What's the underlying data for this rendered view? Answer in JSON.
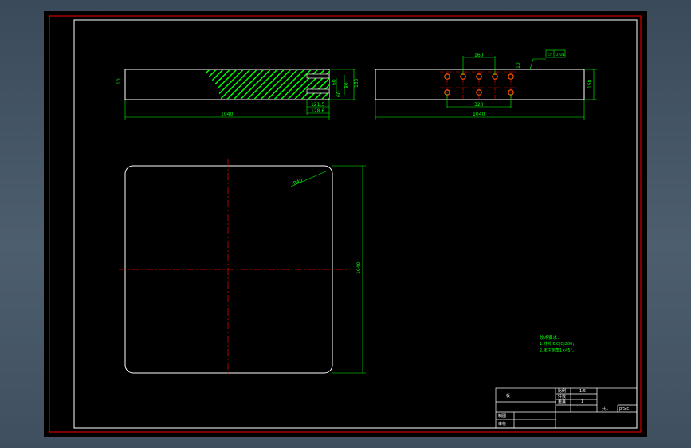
{
  "drawing": {
    "colors": {
      "background": "#000000",
      "frame_outer": "#ff0000",
      "frame_inner": "#ffffff",
      "outline": "#ffffff",
      "dimension": "#00ff00",
      "centerline": "#ff0000",
      "hatch": "#00ff00",
      "hole": "#ff5a00"
    },
    "front_view": {
      "dim_length": "1040",
      "dim_height": "150",
      "dim_thickness": "60",
      "dim_slot_a": "60",
      "dim_slot_b": "80",
      "dim_top": "10",
      "dim_slot_depth": "121.5",
      "dim_slot_total": "128.6"
    },
    "side_view": {
      "dim_length": "1040",
      "dim_height": "150",
      "dim_hole_spacing": "160",
      "dim_hole_span": "320",
      "dim_small": "10",
      "flatness_symbol": "▱",
      "flatness_value": "0.01"
    },
    "plan_view": {
      "dim_radius": "R40",
      "dim_side": "1040"
    },
    "tech_notes": {
      "title": "技术要求：",
      "line1": "1.材料 SiC(C)200；",
      "line2": "2.未注倒角1×45°。"
    },
    "title_block": {
      "part_name": "板",
      "cell_scale_label": "比例",
      "cell_scale_value": "1:5",
      "cell_qty_label": "件数",
      "cell_qty_value": "1",
      "cell_weight_label": "重量",
      "cell_sheet": "共1",
      "cell_material": "p/Sic",
      "cell_drawn": "制图",
      "cell_checked": "审核"
    }
  }
}
